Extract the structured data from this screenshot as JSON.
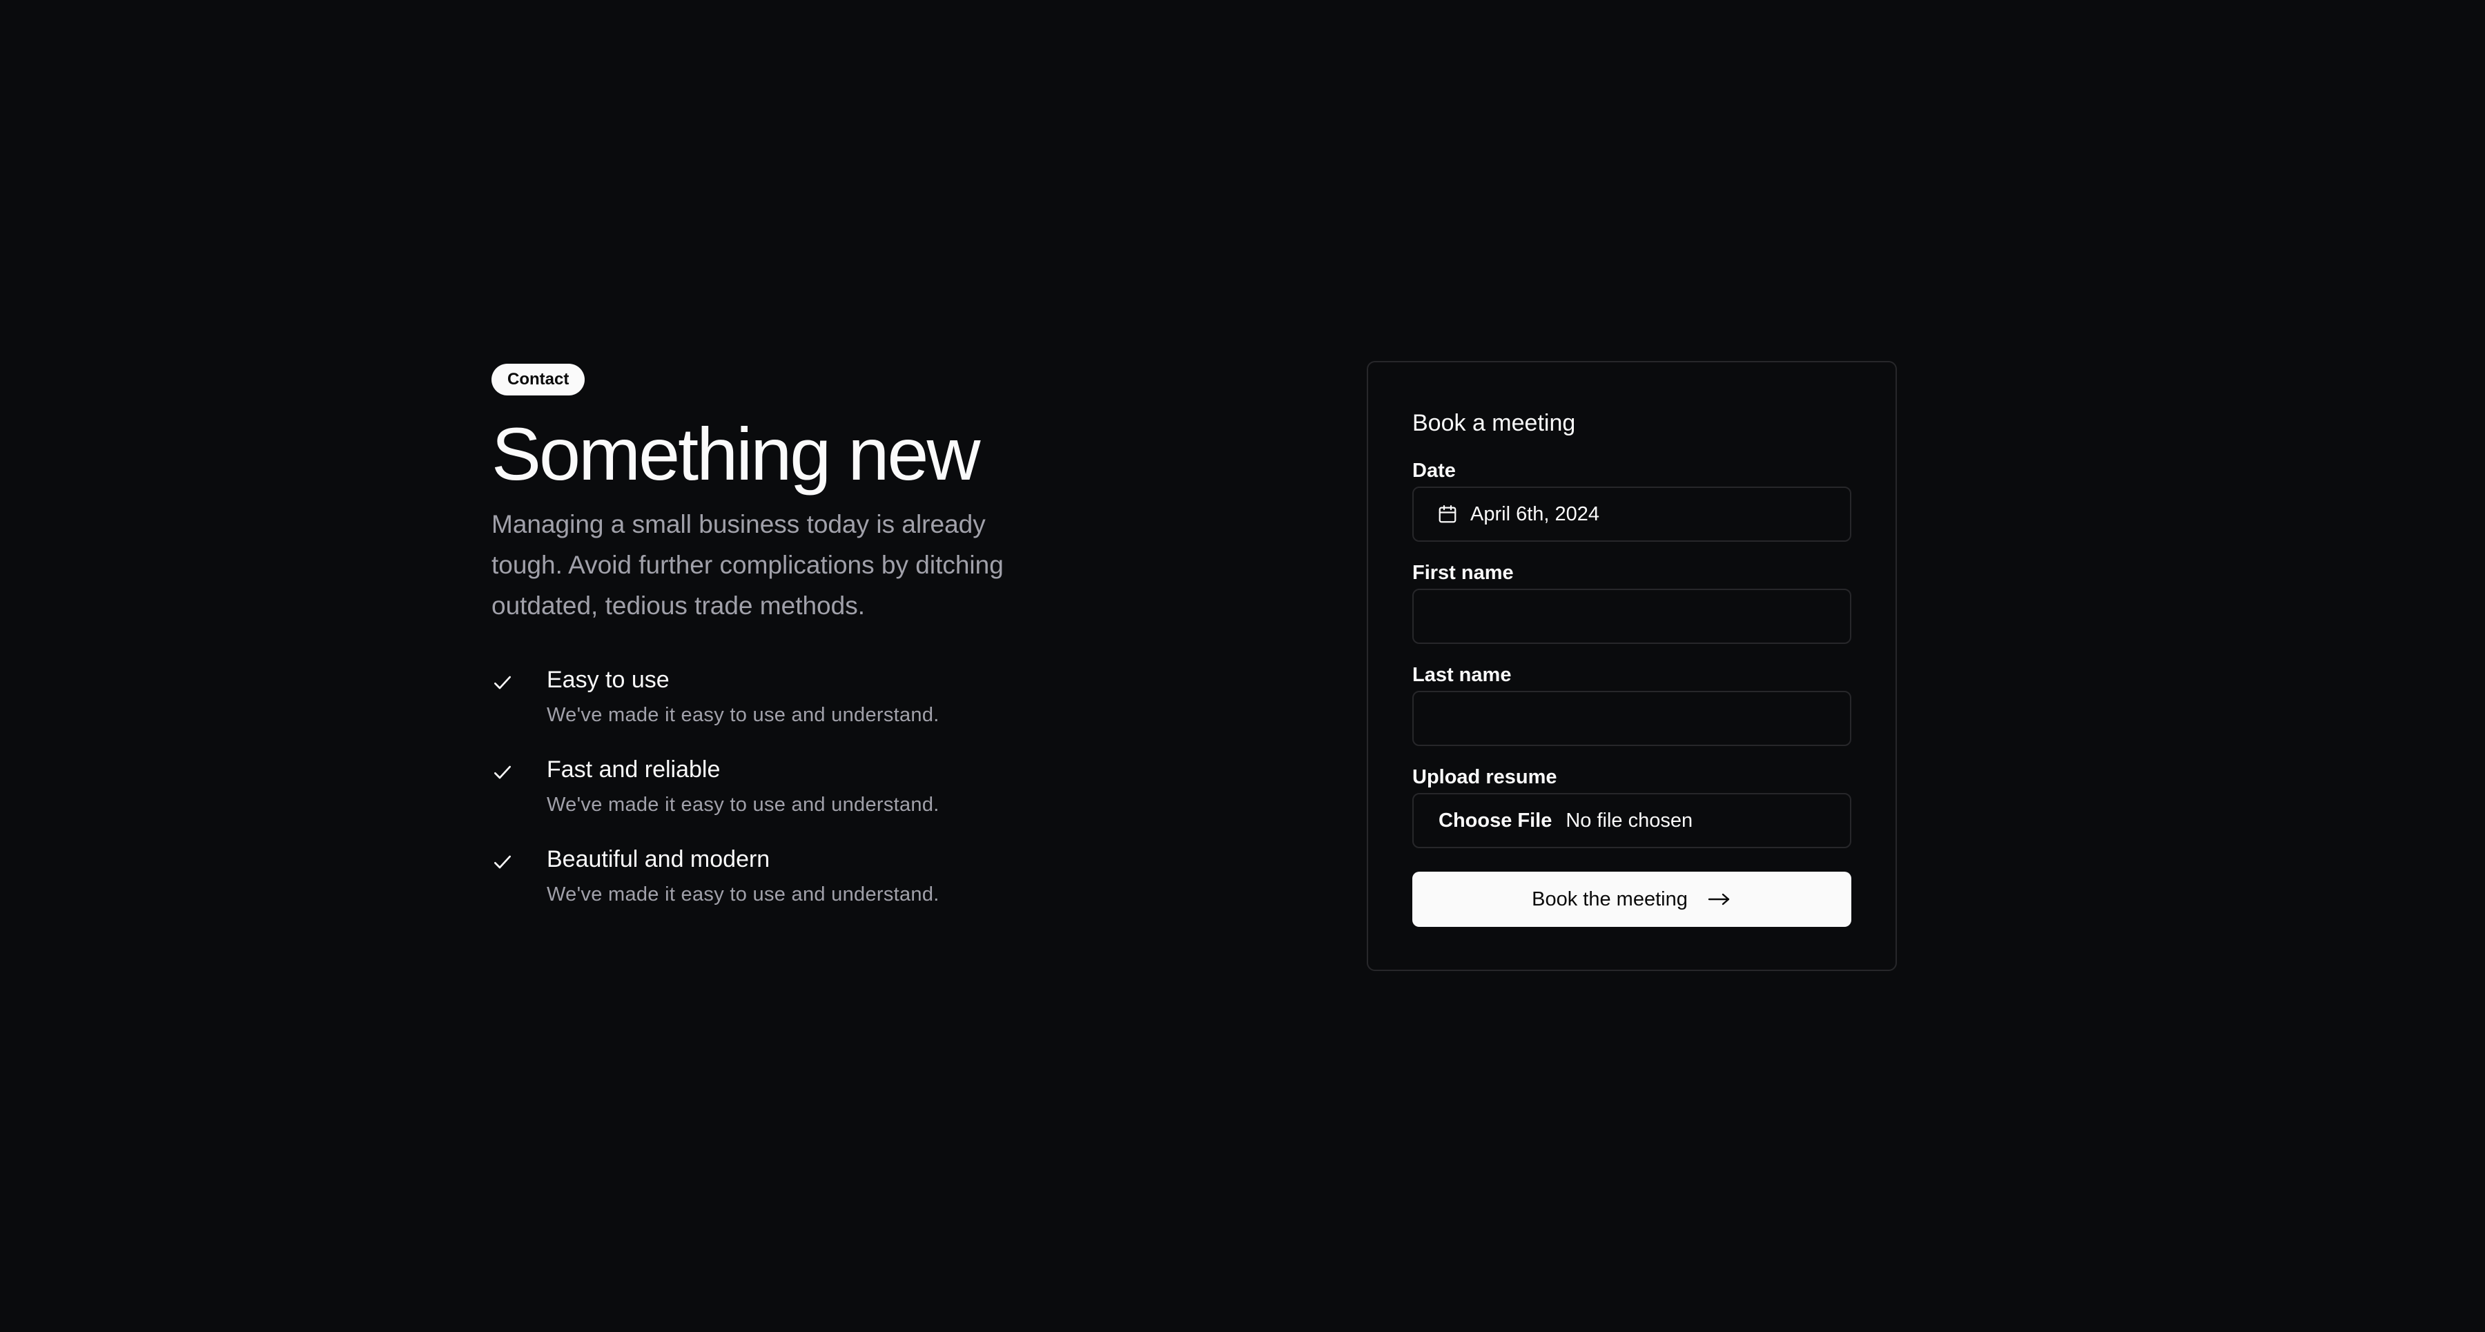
{
  "hero": {
    "badge": "Contact",
    "title": "Something new",
    "description": "Managing a small business today is already tough. Avoid further complications by ditching outdated, tedious trade methods."
  },
  "features": [
    {
      "title": "Easy to use",
      "description": "We've made it easy to use and understand.",
      "icon": "check-icon"
    },
    {
      "title": "Fast and reliable",
      "description": "We've made it easy to use and understand.",
      "icon": "check-icon"
    },
    {
      "title": "Beautiful and modern",
      "description": "We've made it easy to use and understand.",
      "icon": "check-icon"
    }
  ],
  "form": {
    "title": "Book a meeting",
    "date_label": "Date",
    "date_value": "April 6th, 2024",
    "date_icon": "calendar-icon",
    "first_name_label": "First name",
    "first_name_value": "",
    "last_name_label": "Last name",
    "last_name_value": "",
    "resume_label": "Upload resume",
    "file_button": "Choose File",
    "file_status": "No file chosen",
    "submit_label": "Book the meeting",
    "submit_icon": "arrow-right-icon"
  },
  "colors": {
    "background": "#0a0b0d",
    "foreground": "#fafafa",
    "muted": "#a1a1aa",
    "border": "#27272a"
  }
}
